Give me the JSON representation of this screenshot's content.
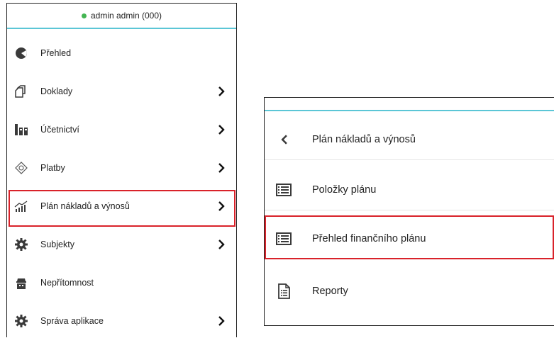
{
  "left_panel": {
    "user": "admin admin (000)",
    "items": [
      {
        "label": "Přehled",
        "icon": "pie-chart-icon",
        "has_submenu": false
      },
      {
        "label": "Doklady",
        "icon": "documents-icon",
        "has_submenu": true
      },
      {
        "label": "Účetnictví",
        "icon": "accounting-icon",
        "has_submenu": true
      },
      {
        "label": "Platby",
        "icon": "payment-icon",
        "has_submenu": true
      },
      {
        "label": "Plán nákladů a výnosů",
        "icon": "growth-chart-icon",
        "has_submenu": true,
        "highlighted": true
      },
      {
        "label": "Subjekty",
        "icon": "gear-icon",
        "has_submenu": true
      },
      {
        "label": "Nepřítomnost",
        "icon": "absence-icon",
        "has_submenu": false
      },
      {
        "label": "Správa aplikace",
        "icon": "gear-icon",
        "has_submenu": true
      }
    ]
  },
  "right_panel": {
    "back_label": "Plán nákladů a výnosů",
    "items": [
      {
        "label": "Položky plánu",
        "icon": "list-icon"
      },
      {
        "label": "Přehled finančního plánu",
        "icon": "list-icon",
        "highlighted": true
      },
      {
        "label": "Reporty",
        "icon": "report-icon"
      }
    ]
  },
  "colors": {
    "accent_line": "#5bc6d6",
    "highlight": "#d9222a",
    "online": "#43b552",
    "icon": "#3a3a3a"
  }
}
